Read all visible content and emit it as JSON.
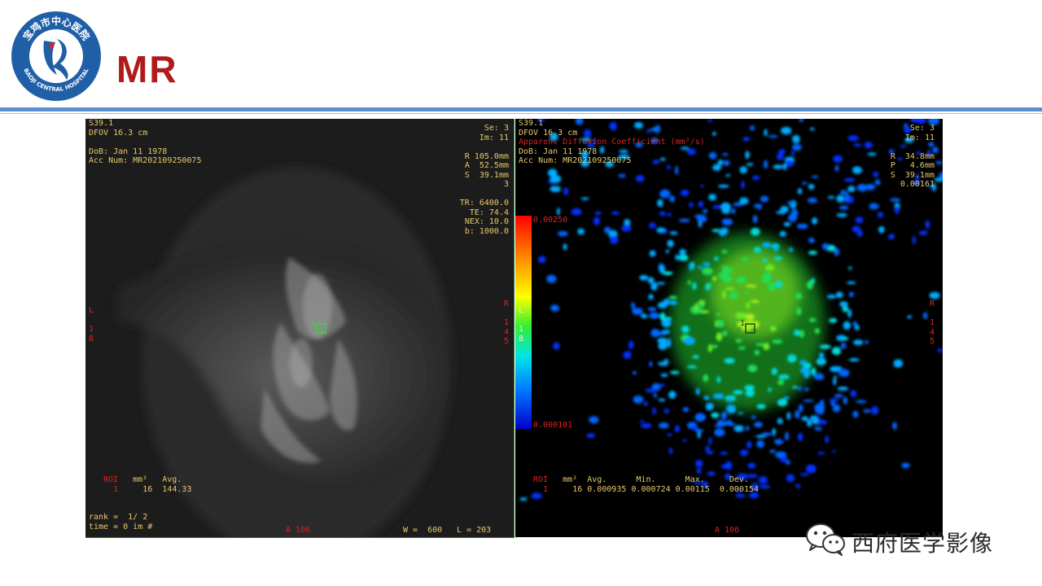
{
  "header": {
    "title": "MR",
    "logo_text_top": "宝鸡市中心医院",
    "logo_text_bottom": "BAOJI CENTRAL HOSPITAL"
  },
  "left_image": {
    "top_left": [
      "S39.1",
      "DFOV 16.3 cm",
      "",
      "DoB: Jan 11 1978",
      "Acc Num: MR202109250075"
    ],
    "top_right": [
      "Se: 3",
      "Im: 11",
      "",
      "R 105.0mm",
      "A  52.5mm",
      "S  39.1mm",
      "3",
      "",
      "TR: 6400.0",
      "TE: 74.4",
      "NEX: 10.0",
      "b: 1000.0"
    ],
    "left_orientation": [
      "L",
      "",
      "1",
      "8"
    ],
    "right_orientation": [
      "R",
      "",
      "1",
      "4",
      "5"
    ],
    "roi_label": "1",
    "roi_table": {
      "headers": [
        "ROI",
        "mm²",
        "Avg."
      ],
      "row": [
        "1",
        "16",
        "144.33"
      ]
    },
    "rank": "rank =  1/ 2",
    "time": "time = 0 im #",
    "bottom_center": "A 106",
    "window": "W =  600",
    "level": "L = 203"
  },
  "right_image": {
    "top_left": [
      "S39.1",
      "DFOV 16.3 cm",
      "Apparent Diffusion Coefficient (mm²/s)",
      "DoB: Jan 11 1978",
      "Acc Num: MR202109250075"
    ],
    "top_right": [
      "Se: 3",
      "Im: 11",
      "",
      "R  34.8mm",
      "P   4.6mm",
      "S  39.1mm",
      "0.00161"
    ],
    "colorbar_max": "0.00250",
    "colorbar_min": "0.000101",
    "left_orientation": [
      "L",
      "",
      "1",
      "8"
    ],
    "right_orientation": [
      "R",
      "",
      "1",
      "4",
      "5"
    ],
    "roi_label": "1",
    "roi_table": {
      "headers": [
        "ROI",
        "mm²",
        "Avg.",
        "Min.",
        "Max.",
        "Dev."
      ],
      "row": [
        "1",
        "16",
        "0.000935",
        "0.000724",
        "0.00115",
        "0.000154"
      ]
    },
    "bottom_center": "A 106"
  },
  "watermark": {
    "text": "西府医学影像"
  },
  "colors": {
    "title_red": "#b01a1a",
    "divider_blue": "#5b8fd0",
    "overlay_yellow": "#e8c86a",
    "overlay_red": "#dd2222",
    "roi_green": "#2ee02e"
  }
}
